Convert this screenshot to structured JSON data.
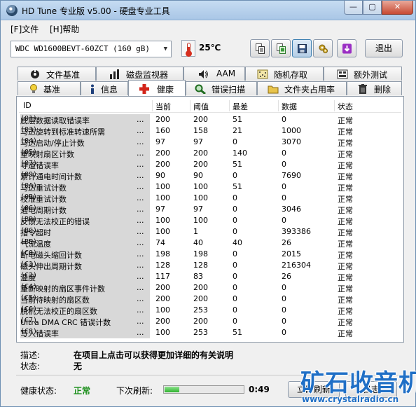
{
  "window": {
    "title": "HD Tune 专业版 v5.00 - 硬盘专业工具",
    "minimize": "—",
    "maximize": "▢",
    "close": "✕"
  },
  "menu": [
    "[F]文件",
    "[H]帮助"
  ],
  "toolbar": {
    "drive": "WDC WD1600BEVT-60ZCT   (160 gB)",
    "temperature": "25℃",
    "exit_label": "退出",
    "icons": [
      "copy-text-icon",
      "copy-screen-icon",
      "save-icon",
      "options-icon",
      "download-icon"
    ]
  },
  "tabs_top": [
    "文件基准",
    "磁盘监视器",
    "AAM",
    "随机存取",
    "额外测试"
  ],
  "tabs_bottom": [
    "基准",
    "信息",
    "健康",
    "错误扫描",
    "文件夹占用率",
    "删除"
  ],
  "selected_tab": "健康",
  "table": {
    "headers": [
      "ID",
      "当前",
      "阈值",
      "最差",
      "数据",
      "状态"
    ],
    "rows": [
      {
        "code": "(01)",
        "name": "底层数据读取错误率",
        "current": "200",
        "threshold": "200",
        "worst": "51",
        "data": "0",
        "status": "正常"
      },
      {
        "code": "(03)",
        "name": "马达旋转到标准转速所需...",
        "current": "160",
        "threshold": "158",
        "worst": "21",
        "data": "1000",
        "status": "正常"
      },
      {
        "code": "(04)",
        "name": "马达启动/停止计数",
        "current": "97",
        "threshold": "97",
        "worst": "0",
        "data": "3070",
        "status": "正常"
      },
      {
        "code": "(05)",
        "name": "重映射扇区计数",
        "current": "200",
        "threshold": "200",
        "worst": "140",
        "data": "0",
        "status": "正常"
      },
      {
        "code": "(07)",
        "name": "寻道错误率",
        "current": "200",
        "threshold": "200",
        "worst": "51",
        "data": "0",
        "status": "正常"
      },
      {
        "code": "(09)",
        "name": "累计通电时间计数",
        "current": "90",
        "threshold": "90",
        "worst": "0",
        "data": "7690",
        "status": "正常"
      },
      {
        "code": "(0A)",
        "name": "马达重试计数",
        "current": "100",
        "threshold": "100",
        "worst": "51",
        "data": "0",
        "status": "正常"
      },
      {
        "code": "(0B)",
        "name": "校准重试计数",
        "current": "100",
        "threshold": "100",
        "worst": "0",
        "data": "0",
        "status": "正常"
      },
      {
        "code": "(0C)",
        "name": "通电周期计数",
        "current": "97",
        "threshold": "97",
        "worst": "0",
        "data": "3046",
        "status": "正常"
      },
      {
        "code": "(BB)",
        "name": "反馈无法校正的错误",
        "current": "100",
        "threshold": "100",
        "worst": "0",
        "data": "0",
        "status": "正常"
      },
      {
        "code": "(BC)",
        "name": "指令超时",
        "current": "100",
        "threshold": "1",
        "worst": "0",
        "data": "393386",
        "status": "正常"
      },
      {
        "code": "(BE)",
        "name": "气流温度",
        "current": "74",
        "threshold": "40",
        "worst": "40",
        "data": "26",
        "status": "正常"
      },
      {
        "code": "(C0)",
        "name": "断电磁头缩回计数",
        "current": "198",
        "threshold": "198",
        "worst": "0",
        "data": "2015",
        "status": "正常"
      },
      {
        "code": "(C1)",
        "name": "磁头伸出周期计数",
        "current": "128",
        "threshold": "128",
        "worst": "0",
        "data": "216304",
        "status": "正常"
      },
      {
        "code": "(C2)",
        "name": "温度",
        "current": "117",
        "threshold": "83",
        "worst": "0",
        "data": "26",
        "status": "正常"
      },
      {
        "code": "(C4)",
        "name": "重新映射的扇区事件计数...",
        "current": "200",
        "threshold": "200",
        "worst": "0",
        "data": "0",
        "status": "正常"
      },
      {
        "code": "(C5)",
        "name": "当前待映射的扇区数",
        "current": "200",
        "threshold": "200",
        "worst": "0",
        "data": "0",
        "status": "正常"
      },
      {
        "code": "(C6)",
        "name": "脱机无法校正的扇区数",
        "current": "100",
        "threshold": "253",
        "worst": "0",
        "data": "0",
        "status": "正常"
      },
      {
        "code": "(C7)",
        "name": "Ultra DMA CRC 错误计数...",
        "current": "200",
        "threshold": "200",
        "worst": "0",
        "data": "0",
        "status": "正常"
      },
      {
        "code": "(C8)",
        "name": "写入错误率",
        "current": "100",
        "threshold": "253",
        "worst": "51",
        "data": "0",
        "status": "正常"
      }
    ]
  },
  "description": {
    "desc_label": "描述:",
    "desc_value": "在项目上点击可以获得更加详细的有关说明",
    "status_label": "状态:",
    "status_value": "无"
  },
  "status_bar": {
    "health_label": "健康状态:",
    "health_value": "正常",
    "refresh_label": "下次刷新:",
    "refresh_progress": 0.18,
    "timer": "0:49",
    "refresh_button": "立即刷新",
    "log_button": "日志"
  },
  "watermark": {
    "main": "矿石收音机",
    "url": "www.crystalradio.cn"
  }
}
